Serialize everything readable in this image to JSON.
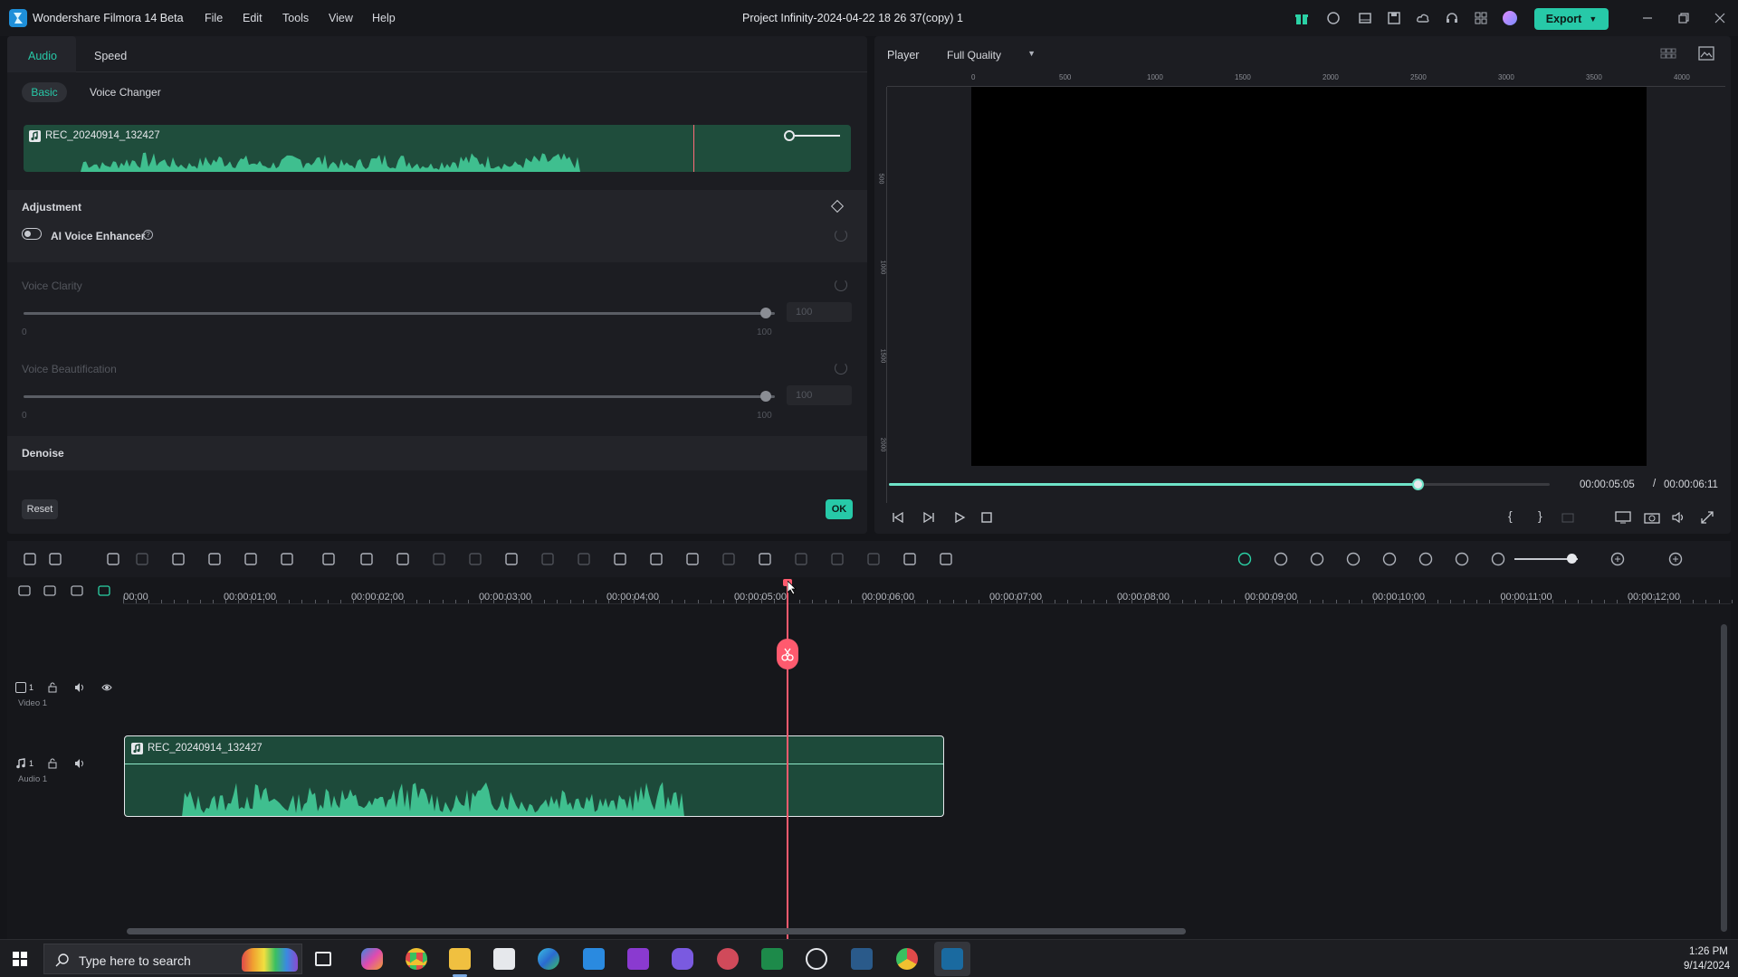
{
  "app": {
    "title": "Wondershare Filmora 14 Beta",
    "project_title": "Project Infinity-2024-04-22 18 26 37(copy) 1",
    "export_label": "Export"
  },
  "menu": [
    "File",
    "Edit",
    "Tools",
    "View",
    "Help"
  ],
  "left_panel": {
    "tabs": [
      "Audio",
      "Speed"
    ],
    "subtabs": [
      "Basic",
      "Voice Changer"
    ],
    "clip_name": "REC_20240914_132427",
    "adjustment_label": "Adjustment",
    "ai_voice_enhancer": {
      "label": "AI Voice Enhancer",
      "enabled": false
    },
    "voice_clarity": {
      "label": "Voice Clarity",
      "value": "100",
      "min": "0",
      "max": "100"
    },
    "voice_beautification": {
      "label": "Voice Beautification",
      "value": "100",
      "min": "0",
      "max": "100"
    },
    "denoise_label": "Denoise",
    "reset_label": "Reset",
    "ok_label": "OK"
  },
  "player": {
    "label": "Player",
    "quality": "Full Quality",
    "current_time": "00:00:05:05",
    "separator": "/",
    "total_time": "00:00:06:11",
    "progress": 0.8,
    "ruler_h": [
      "0",
      "500",
      "1000",
      "1500",
      "2000",
      "2500",
      "3000",
      "3500",
      "4000"
    ],
    "ruler_v": [
      "500",
      "1000",
      "1500",
      "2000"
    ]
  },
  "timeline": {
    "ruler": [
      "00:00",
      "00:00:01:00",
      "00:00:02:00",
      "00:00:03:00",
      "00:00:04:00",
      "00:00:05:00",
      "00:00:06:00",
      "00:00:07:00",
      "00:00:08:00",
      "00:00:09:00",
      "00:00:10:00",
      "00:00:11:00",
      "00:00:12:00"
    ],
    "video_track_label": "Video 1",
    "audio_track_label": "Audio 1",
    "video_track_num": "1",
    "audio_track_num": "1",
    "audio_clip_name": "REC_20240914_132427"
  },
  "taskbar": {
    "search_placeholder": "Type here to search",
    "time": "1:26 PM",
    "date": "9/14/2024"
  },
  "colors": {
    "accent": "#27c9a8",
    "playhead": "#ff5a6e",
    "audio_clip": "#1d4a3a",
    "waveform": "#3fbf8f"
  }
}
